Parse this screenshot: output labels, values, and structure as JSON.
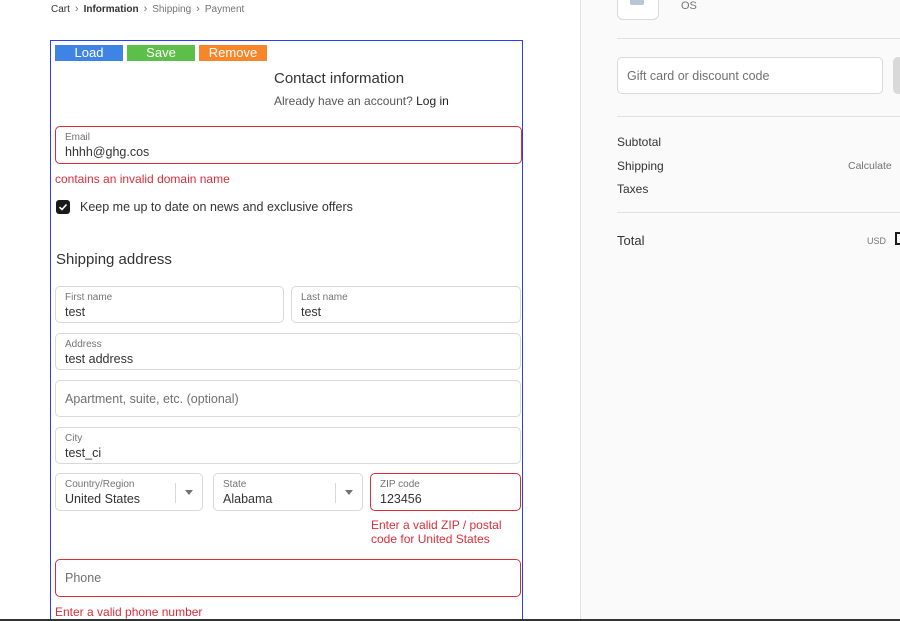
{
  "breadcrumb": {
    "cart": "Cart",
    "information": "Information",
    "shipping": "Shipping",
    "payment": "Payment",
    "separator": "›"
  },
  "toolbar": {
    "load": "Load",
    "save": "Save",
    "remove": "Remove"
  },
  "contact": {
    "title": "Contact information",
    "account_prompt": "Already have an account?",
    "login_link": "Log in",
    "email_label": "Email",
    "email_value": "hhhh@ghg.cos",
    "email_error": "contains an invalid domain name",
    "newsletter_label": "Keep me up to date on news and exclusive offers",
    "newsletter_checked": true
  },
  "shipping": {
    "title": "Shipping address",
    "first_name_label": "First name",
    "first_name_value": "test",
    "last_name_label": "Last name",
    "last_name_value": "test",
    "address_label": "Address",
    "address_value": "test address",
    "apartment_placeholder": "Apartment, suite, etc. (optional)",
    "city_label": "City",
    "city_value": "test_ci",
    "country_label": "Country/Region",
    "country_value": "United States",
    "state_label": "State",
    "state_value": "Alabama",
    "zip_label": "ZIP code",
    "zip_value": "123456",
    "zip_error": "Enter a valid ZIP / postal code for United States",
    "phone_placeholder": "Phone",
    "phone_error": "Enter a valid phone number"
  },
  "summary": {
    "product_name": "OS",
    "gift_placeholder": "Gift card or discount code",
    "subtotal_label": "Subtotal",
    "shipping_label": "Shipping",
    "shipping_value": "Calculate",
    "taxes_label": "Taxes",
    "total_label": "Total",
    "total_currency": "USD"
  },
  "colors": {
    "accent_error": "#d92d3a",
    "btn_load": "#3f84e5",
    "btn_save": "#5cbf4a",
    "btn_remove": "#f7862a",
    "form_outline": "#2a3cff"
  }
}
